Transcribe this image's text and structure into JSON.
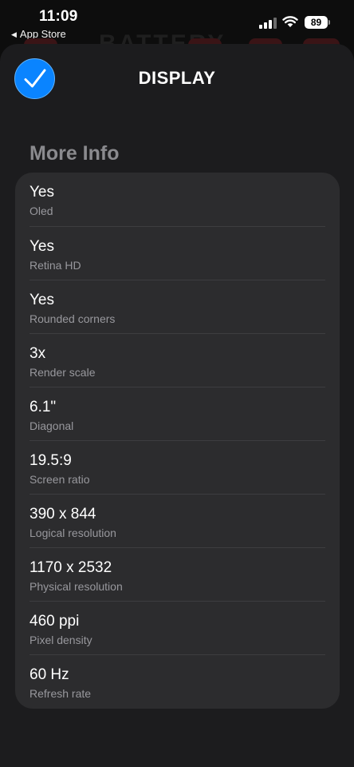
{
  "status_bar": {
    "time": "11:09",
    "back_label": "App Store",
    "battery_level": "89",
    "icons": [
      "signal-icon",
      "wifi-icon",
      "battery-icon"
    ]
  },
  "background_app": {
    "partial_title": "BATTERY"
  },
  "sheet": {
    "title": "DISPLAY",
    "done_icon": "checkmark-icon",
    "accent_color": "#0a84ff",
    "section_title": "More Info",
    "rows": [
      {
        "value": "Yes",
        "label": "Oled"
      },
      {
        "value": "Yes",
        "label": "Retina HD"
      },
      {
        "value": "Yes",
        "label": "Rounded corners"
      },
      {
        "value": "3x",
        "label": "Render scale"
      },
      {
        "value": "6.1\"",
        "label": "Diagonal"
      },
      {
        "value": "19.5:9",
        "label": "Screen ratio"
      },
      {
        "value": "390 x 844",
        "label": "Logical resolution"
      },
      {
        "value": "1170 x 2532",
        "label": "Physical resolution"
      },
      {
        "value": "460 ppi",
        "label": "Pixel density"
      },
      {
        "value": "60 Hz",
        "label": "Refresh rate"
      }
    ]
  }
}
